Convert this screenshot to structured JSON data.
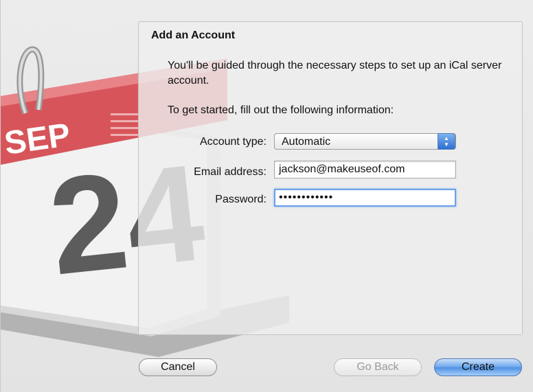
{
  "dialog": {
    "title": "Add an Account",
    "intro": "You'll be guided through the necessary steps to set up an iCal server account.",
    "instruction": "To get started, fill out the following information:"
  },
  "form": {
    "account_type_label": "Account type:",
    "account_type_value": "Automatic",
    "email_label": "Email address:",
    "email_value": "jackson@makeuseof.com",
    "password_label": "Password:",
    "password_masked": "••••••••••••"
  },
  "calendar_icon": {
    "month": "SEP",
    "day": "24"
  },
  "buttons": {
    "cancel": "Cancel",
    "go_back": "Go Back",
    "create": "Create"
  },
  "icons": {
    "popup_stepper": "up-down-arrows-icon",
    "calendar": "ical-calendar-icon"
  },
  "colors": {
    "calendar_red": "#d7555a",
    "focus_blue": "#6aa0e8",
    "default_button_blue": "#5b9ae8"
  }
}
